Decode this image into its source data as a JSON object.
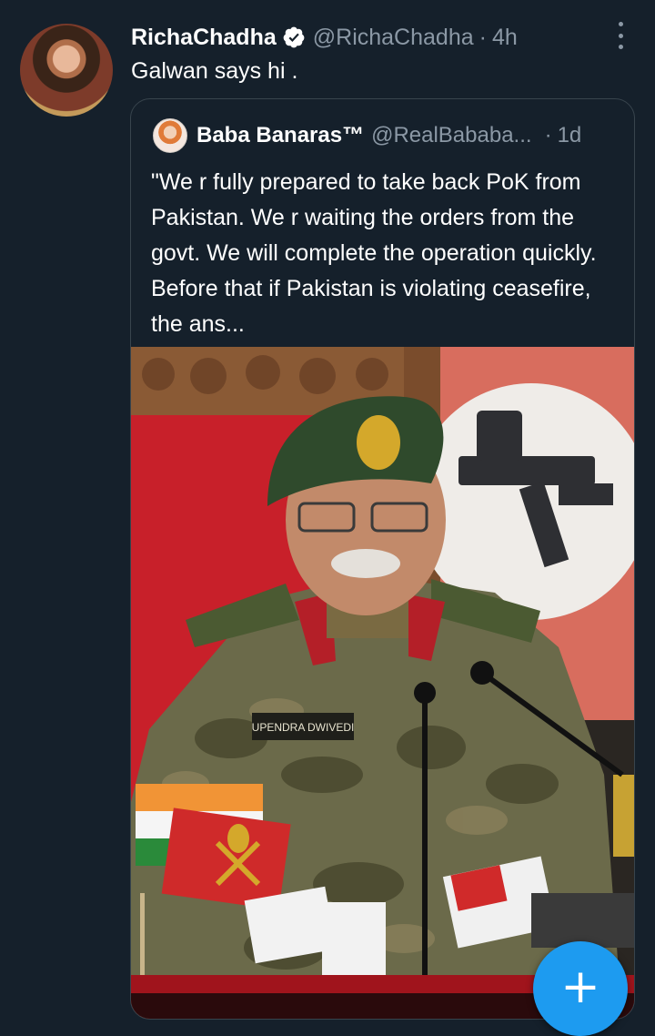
{
  "tweet": {
    "author": {
      "display_name": "RichaChadha",
      "handle": "@RichaChadha",
      "verified": true
    },
    "separator": "·",
    "time": "4h",
    "text": "Galwan says hi .",
    "more_icon": "more-vertical-icon"
  },
  "quoted_tweet": {
    "author": {
      "display_name": "Baba Banaras™",
      "handle": "@RealBababa..."
    },
    "separator": "·",
    "time": "1d",
    "text": "\"We r fully prepared to take back PoK from Pakistan. We r waiting the orders from the govt. We will complete the operation quickly. Before that if Pakistan is violating ceasefire, the ans...",
    "image": {
      "name_tag": "UPENDRA DWIVEDI"
    }
  },
  "compose_button": {
    "icon": "plus-icon",
    "label": "+"
  },
  "colors": {
    "background": "#15202b",
    "accent": "#1d9bf0",
    "muted": "#8b98a5",
    "border": "#38444d"
  }
}
